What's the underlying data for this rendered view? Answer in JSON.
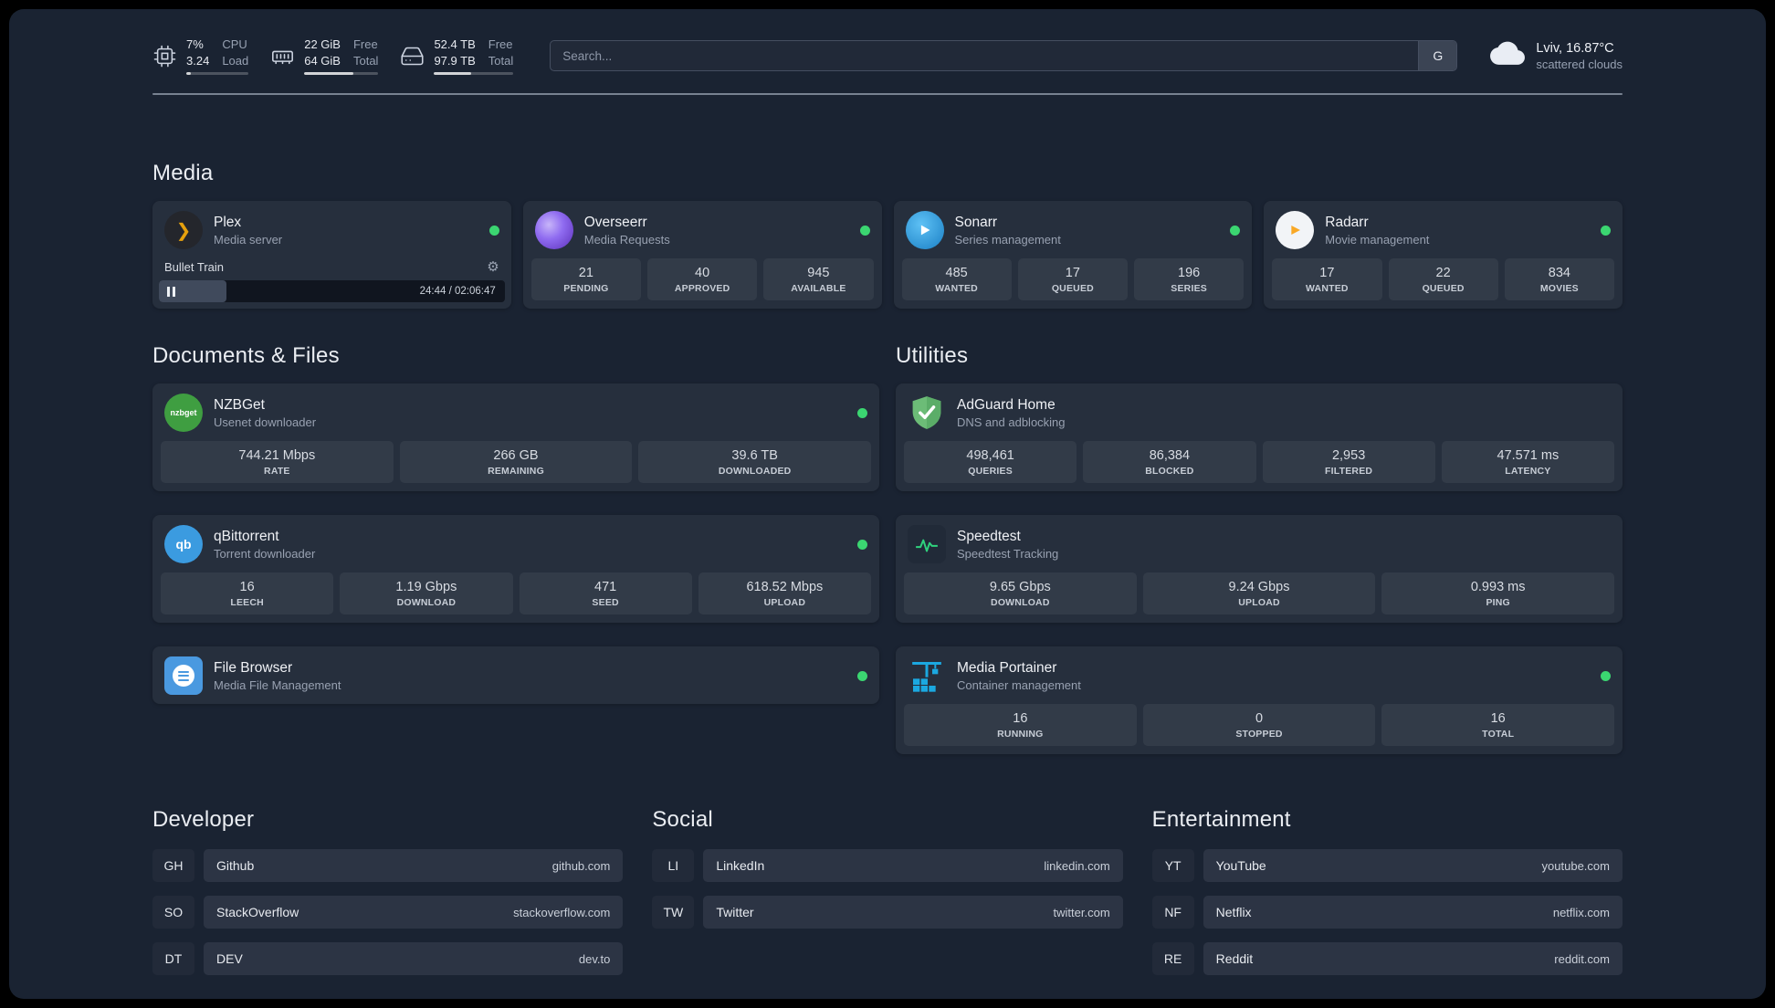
{
  "infobar": {
    "cpu": {
      "icon": "cpu-chip",
      "value_top": "7%",
      "value_bottom": "3.24",
      "label_top": "CPU",
      "label_bottom": "Load",
      "bar_percent": 7
    },
    "memory": {
      "icon": "memory-stick",
      "value_top": "22 GiB",
      "value_bottom": "64 GiB",
      "label_top": "Free",
      "label_bottom": "Total",
      "bar_percent": 66
    },
    "disk": {
      "icon": "hard-drive",
      "value_top": "52.4 TB",
      "value_bottom": "97.9 TB",
      "label_top": "Free",
      "label_bottom": "Total",
      "bar_percent": 47
    },
    "search": {
      "placeholder": "Search...",
      "button_label": "G"
    },
    "weather": {
      "icon": "cloud",
      "location": "Lviv, 16.87°C",
      "condition": "scattered clouds"
    }
  },
  "sections": {
    "media": {
      "title": "Media"
    },
    "documents": {
      "title": "Documents & Files"
    },
    "utilities": {
      "title": "Utilities"
    }
  },
  "media_cards": [
    {
      "id": "plex",
      "name": "Plex",
      "desc": "Media server",
      "status": "online",
      "player": {
        "title": "Bullet Train",
        "time": "24:44 / 02:06:47",
        "progress_percent": 19.5
      }
    },
    {
      "id": "overseerr",
      "name": "Overseerr",
      "desc": "Media Requests",
      "status": "online",
      "stats": [
        {
          "value": "21",
          "label": "PENDING"
        },
        {
          "value": "40",
          "label": "APPROVED"
        },
        {
          "value": "945",
          "label": "AVAILABLE"
        }
      ]
    },
    {
      "id": "sonarr",
      "name": "Sonarr",
      "desc": "Series management",
      "status": "online",
      "stats": [
        {
          "value": "485",
          "label": "WANTED"
        },
        {
          "value": "17",
          "label": "QUEUED"
        },
        {
          "value": "196",
          "label": "SERIES"
        }
      ]
    },
    {
      "id": "radarr",
      "name": "Radarr",
      "desc": "Movie management",
      "status": "online",
      "stats": [
        {
          "value": "17",
          "label": "WANTED"
        },
        {
          "value": "22",
          "label": "QUEUED"
        },
        {
          "value": "834",
          "label": "MOVIES"
        }
      ]
    }
  ],
  "documents_cards": [
    {
      "id": "nzbget",
      "name": "NZBGet",
      "desc": "Usenet downloader",
      "icon_text": "nzbget",
      "status": "online",
      "stats": [
        {
          "value": "744.21 Mbps",
          "label": "RATE"
        },
        {
          "value": "266 GB",
          "label": "REMAINING"
        },
        {
          "value": "39.6 TB",
          "label": "DOWNLOADED"
        }
      ]
    },
    {
      "id": "qbittorrent",
      "name": "qBittorrent",
      "desc": "Torrent downloader",
      "icon_text": "qb",
      "status": "online",
      "stats": [
        {
          "value": "16",
          "label": "LEECH"
        },
        {
          "value": "1.19 Gbps",
          "label": "DOWNLOAD"
        },
        {
          "value": "471",
          "label": "SEED"
        },
        {
          "value": "618.52 Mbps",
          "label": "UPLOAD"
        }
      ]
    },
    {
      "id": "filebrowser",
      "name": "File Browser",
      "desc": "Media File Management",
      "status": "online"
    }
  ],
  "utilities_cards": [
    {
      "id": "adguard",
      "name": "AdGuard Home",
      "desc": "DNS and adblocking",
      "stats": [
        {
          "value": "498,461",
          "label": "QUERIES"
        },
        {
          "value": "86,384",
          "label": "BLOCKED"
        },
        {
          "value": "2,953",
          "label": "FILTERED"
        },
        {
          "value": "47.571 ms",
          "label": "LATENCY"
        }
      ]
    },
    {
      "id": "speedtest",
      "name": "Speedtest",
      "desc": "Speedtest Tracking",
      "stats": [
        {
          "value": "9.65 Gbps",
          "label": "DOWNLOAD"
        },
        {
          "value": "9.24 Gbps",
          "label": "UPLOAD"
        },
        {
          "value": "0.993 ms",
          "label": "PING"
        }
      ]
    },
    {
      "id": "portainer",
      "name": "Media Portainer",
      "desc": "Container management",
      "status": "online",
      "stats": [
        {
          "value": "16",
          "label": "RUNNING"
        },
        {
          "value": "0",
          "label": "STOPPED"
        },
        {
          "value": "16",
          "label": "TOTAL"
        }
      ]
    }
  ],
  "bookmarks": {
    "developer": {
      "title": "Developer",
      "items": [
        {
          "abbr": "GH",
          "name": "Github",
          "url": "github.com"
        },
        {
          "abbr": "SO",
          "name": "StackOverflow",
          "url": "stackoverflow.com"
        },
        {
          "abbr": "DT",
          "name": "DEV",
          "url": "dev.to"
        }
      ]
    },
    "social": {
      "title": "Social",
      "items": [
        {
          "abbr": "LI",
          "name": "LinkedIn",
          "url": "linkedin.com"
        },
        {
          "abbr": "TW",
          "name": "Twitter",
          "url": "twitter.com"
        }
      ]
    },
    "entertainment": {
      "title": "Entertainment",
      "items": [
        {
          "abbr": "YT",
          "name": "YouTube",
          "url": "youtube.com"
        },
        {
          "abbr": "NF",
          "name": "Netflix",
          "url": "netflix.com"
        },
        {
          "abbr": "RE",
          "name": "Reddit",
          "url": "reddit.com"
        }
      ]
    }
  },
  "colors": {
    "status_online": "#3bd671",
    "plex_amber": "#e5a00d",
    "overseerr_purple": "#8f6bf0",
    "sonarr_blue": "#35a7e8",
    "radarr_amber": "#f9a825",
    "nzbget_green": "#3f9e41",
    "qbittorrent_blue": "#3b9be0",
    "filebrowser_blue": "#4a99e0",
    "adguard_green": "#63b272",
    "speedtest_green": "#2fd27d",
    "portainer_blue": "#1ba8e0"
  }
}
